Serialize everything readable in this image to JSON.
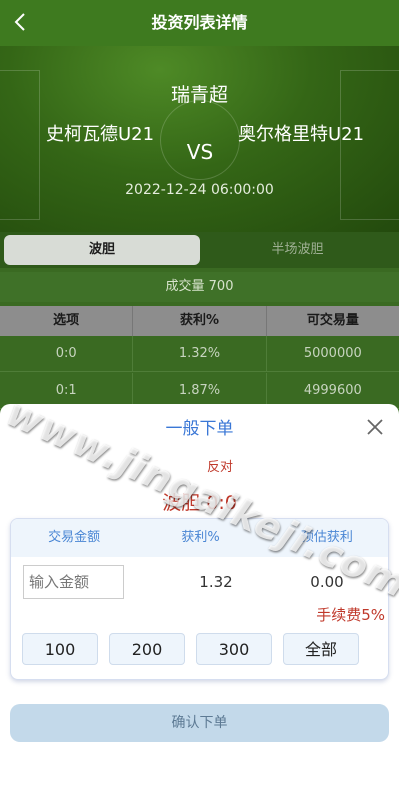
{
  "header": {
    "title": "投资列表详情",
    "back_icon": "chevron-left-icon"
  },
  "match": {
    "league": "瑞青超",
    "home_team": "史柯瓦德U21",
    "vs": "VS",
    "away_team": "奥尔格里特U21",
    "time": "2022-12-24 06:00:00"
  },
  "tabs": [
    {
      "label": "波胆",
      "active": true
    },
    {
      "label": "半场波胆",
      "active": false
    }
  ],
  "volume": "成交量 700",
  "table": {
    "columns": [
      "选项",
      "获利%",
      "可交易量"
    ],
    "rows": [
      [
        "0:0",
        "1.32%",
        "5000000"
      ],
      [
        "0:1",
        "1.87%",
        "4999600"
      ]
    ]
  },
  "watermark": "www.jingaikeji.com",
  "modal": {
    "title": "一般下单",
    "direction": "反对",
    "selection": "波胆 0:0",
    "columns": [
      "交易金额",
      "获利%",
      "预估获利"
    ],
    "amount_placeholder": "输入金额",
    "odds": "1.32",
    "estimated_profit": "0.00",
    "fee": "手续费5%",
    "quick_amounts": [
      "100",
      "200",
      "300",
      "全部"
    ],
    "confirm_label": "确认下单",
    "close_icon": "close-icon"
  },
  "colors": {
    "accent": "#3a77d6",
    "danger": "#c0392b",
    "header_green": "#3e7a1f"
  }
}
